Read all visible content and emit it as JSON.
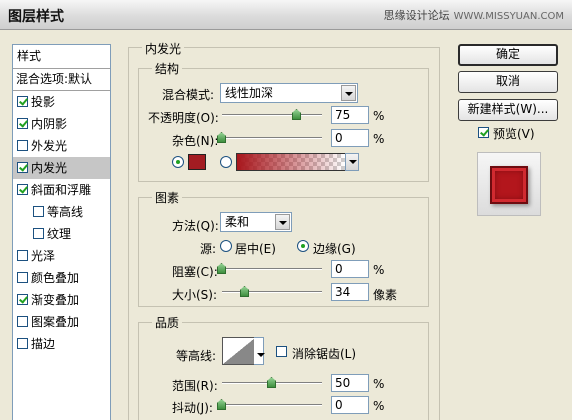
{
  "window": {
    "title": "图层样式",
    "watermark_cn": "思缘设计论坛",
    "watermark_url": "WWW.MISSYUAN.COM"
  },
  "sidebar": {
    "header": "样式",
    "blend_options": "混合选项:默认",
    "items": [
      {
        "label": "投影",
        "checked": true
      },
      {
        "label": "内阴影",
        "checked": true
      },
      {
        "label": "外发光",
        "checked": false
      },
      {
        "label": "内发光",
        "checked": true,
        "selected": true
      },
      {
        "label": "斜面和浮雕",
        "checked": true
      },
      {
        "label": "等高线",
        "checked": false,
        "indent": true
      },
      {
        "label": "纹理",
        "checked": false,
        "indent": true
      },
      {
        "label": "光泽",
        "checked": false
      },
      {
        "label": "颜色叠加",
        "checked": false
      },
      {
        "label": "渐变叠加",
        "checked": true
      },
      {
        "label": "图案叠加",
        "checked": false
      },
      {
        "label": "描边",
        "checked": false
      }
    ]
  },
  "panel": {
    "title": "内发光",
    "structure": {
      "legend": "结构",
      "blend_mode_label": "混合模式:",
      "blend_mode_value": "线性加深",
      "opacity_label": "不透明度(O):",
      "opacity_value": "75",
      "opacity_fraction": 0.75,
      "noise_label": "杂色(N):",
      "noise_value": "0",
      "noise_fraction": 0,
      "percent": "%",
      "glow_color": "#a31c22"
    },
    "elements": {
      "legend": "图素",
      "technique_label": "方法(Q):",
      "technique_value": "柔和",
      "source_label": "源:",
      "source_center": "居中(E)",
      "source_edge": "边缘(G)",
      "choke_label": "阻塞(C):",
      "choke_value": "0",
      "choke_fraction": 0,
      "size_label": "大小(S):",
      "size_value": "34",
      "size_unit": "像素",
      "percent": "%"
    },
    "quality": {
      "legend": "品质",
      "contour_label": "等高线:",
      "antialias_label": "消除锯齿(L)",
      "range_label": "范围(R):",
      "range_value": "50",
      "range_fraction": 0.5,
      "jitter_label": "抖动(J):",
      "jitter_value": "0",
      "jitter_fraction": 0,
      "percent": "%"
    }
  },
  "buttons": {
    "ok": "确定",
    "cancel": "取消",
    "new_style": "新建样式(W)...",
    "preview_label": "预览(V)"
  },
  "preview": {
    "color": "#b3161c"
  }
}
